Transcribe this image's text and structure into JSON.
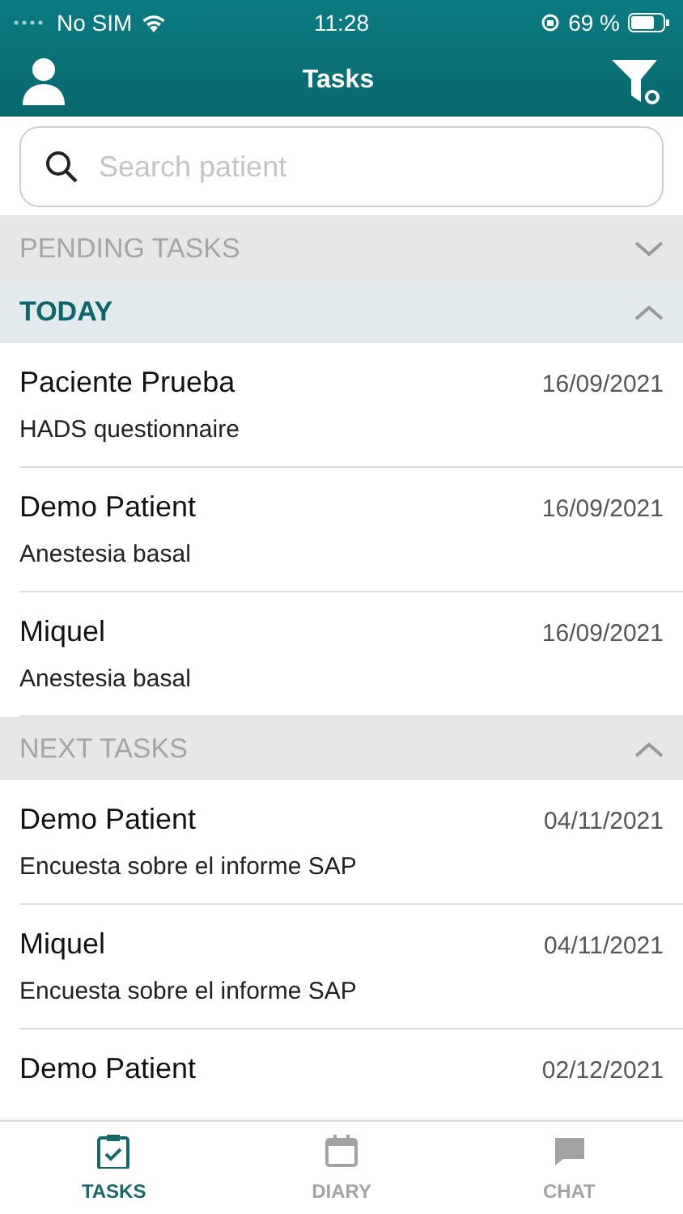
{
  "status_bar": {
    "carrier": "No SIM",
    "time": "11:28",
    "battery": "69 %"
  },
  "header": {
    "title": "Tasks"
  },
  "search": {
    "placeholder": "Search patient"
  },
  "sections": [
    {
      "title": "PENDING TASKS",
      "kind": "group",
      "expanded": false
    },
    {
      "title": "TODAY",
      "kind": "current",
      "expanded": true,
      "tasks": [
        {
          "patient": "Paciente Prueba",
          "date": "16/09/2021",
          "task": "HADS questionnaire"
        },
        {
          "patient": "Demo Patient",
          "date": "16/09/2021",
          "task": "Anestesia basal"
        },
        {
          "patient": "Miquel",
          "date": "16/09/2021",
          "task": "Anestesia basal"
        }
      ]
    },
    {
      "title": "NEXT TASKS",
      "kind": "group",
      "expanded": true,
      "tasks": [
        {
          "patient": "Demo Patient",
          "date": "04/11/2021",
          "task": "Encuesta sobre el informe SAP"
        },
        {
          "patient": "Miquel",
          "date": "04/11/2021",
          "task": "Encuesta sobre el informe SAP"
        },
        {
          "patient": "Demo Patient",
          "date": "02/12/2021"
        }
      ]
    }
  ],
  "tab_bar": [
    {
      "label": "TASKS",
      "kind": "clipboard",
      "selected": true
    },
    {
      "label": "DIARY",
      "kind": "calendar",
      "selected": false
    },
    {
      "label": "CHAT",
      "kind": "chat",
      "selected": false
    }
  ]
}
